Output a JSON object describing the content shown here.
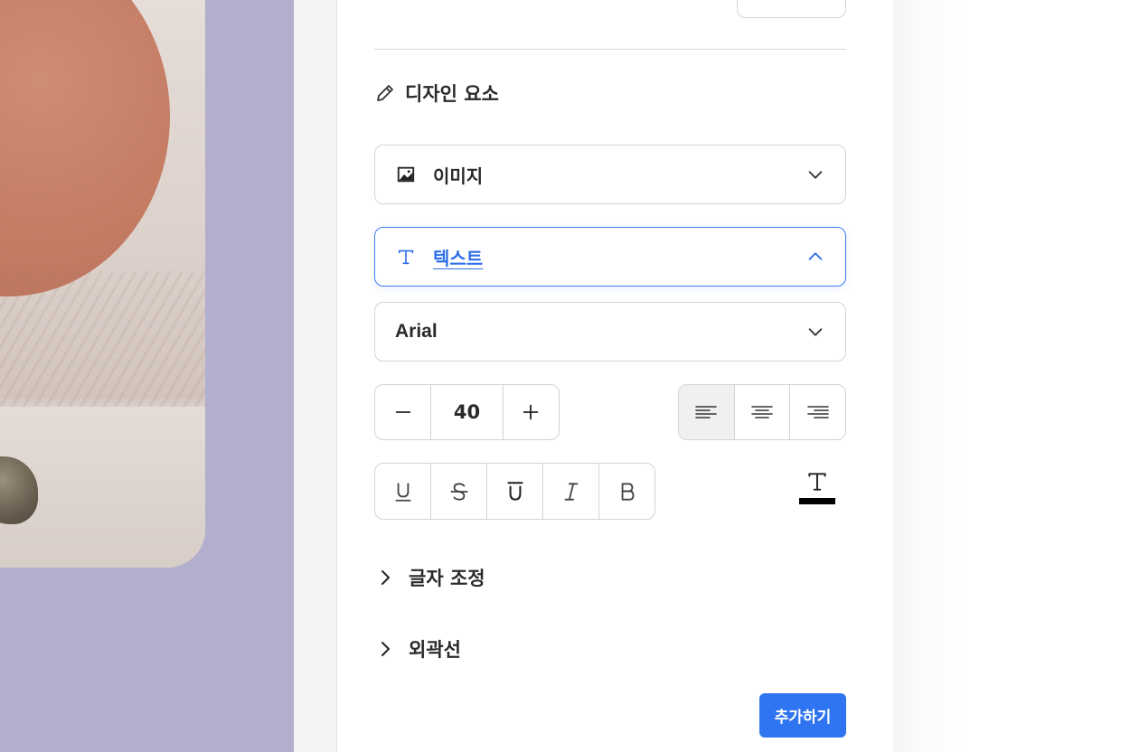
{
  "panel": {
    "section_title": "디자인 요소",
    "image_dropdown": {
      "label": "이미지",
      "icon": "image-icon",
      "state": "collapsed"
    },
    "text_dropdown": {
      "label": "텍스트",
      "icon": "text-t-icon",
      "state": "expanded",
      "accent": "#3e7df2"
    },
    "font": {
      "selected": "Arial"
    },
    "font_size": {
      "value": "40",
      "decrement": "−",
      "increment": "+"
    },
    "alignment": {
      "options": [
        "left",
        "center",
        "right"
      ],
      "active": "left"
    },
    "text_styles": [
      "underline",
      "strikethrough",
      "overline",
      "italic",
      "bold"
    ],
    "text_color": {
      "value": "#000000"
    },
    "sections": {
      "letter_adjust": "글자 조정",
      "outline": "외곽선"
    },
    "add_button": "추가하기",
    "add_button_color": "#2f74f0"
  },
  "canvas": {
    "background": "#b2afcd"
  }
}
